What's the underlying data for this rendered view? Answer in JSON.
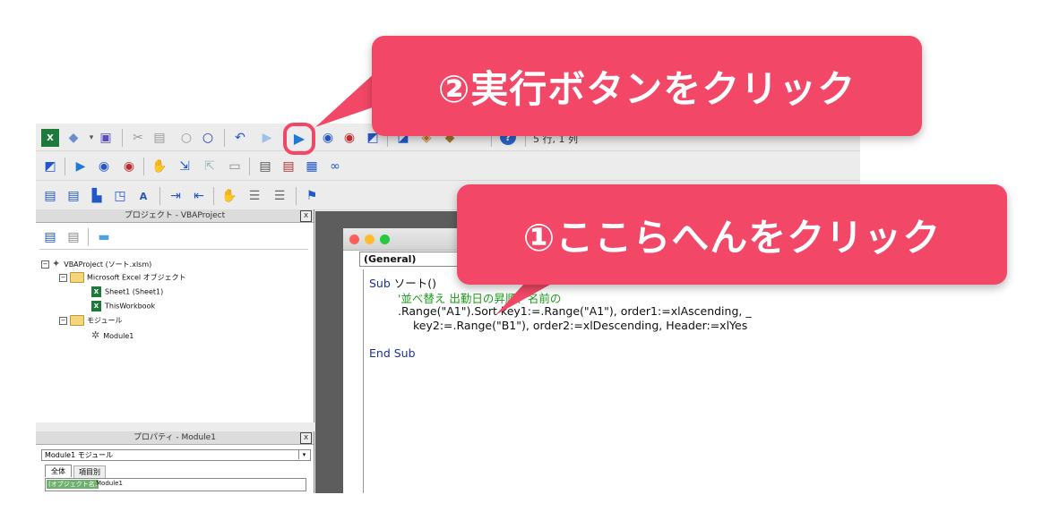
{
  "toolbar": {
    "status_text": "5 行, 1 列"
  },
  "project_panel": {
    "title": "プロジェクト - VBAProject",
    "close": "x",
    "root": "VBAProject (ソート.xlsm)",
    "folder_objects": "Microsoft Excel オブジェクト",
    "sheet1": "Sheet1 (Sheet1)",
    "workbook": "ThisWorkbook",
    "folder_modules": "モジュール",
    "module1": "Module1",
    "xl_glyph": "X"
  },
  "properties_panel": {
    "title": "プロパティ - Module1",
    "close": "x",
    "object_select": "Module1  モジュール",
    "tab_all": "全体",
    "tab_category": "項目別",
    "prop_name_label": "(オブジェクト名)",
    "prop_name_value": "Module1"
  },
  "code_window": {
    "general_dropdown": "(General)",
    "lines": {
      "l1_kw": "Sub",
      "l1_rest": " ソート()",
      "l2": "'並べ替え 出勤日の昇順、名前の",
      "l3": ".Range(\"A1\").Sort key1:=.Range(\"A1\"), order1:=xlAscending, _",
      "l4": "key2:=.Range(\"B1\"), order2:=xlDescending, Header:=xlYes",
      "l5": "End Sub"
    }
  },
  "callouts": {
    "run_button": "②実行ボタンをクリック",
    "click_here": "①ここらへんをクリック"
  },
  "colors": {
    "callout": "#f24766",
    "run_blue": "#1f7ad6",
    "keyword": "#1c2ea0",
    "comment": "#1a9b1a"
  }
}
